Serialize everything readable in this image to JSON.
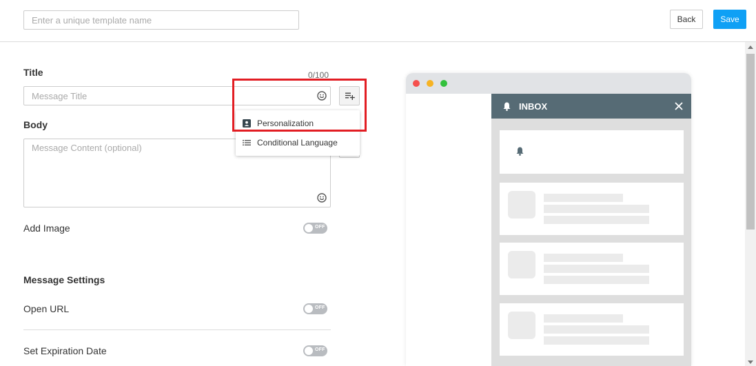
{
  "header": {
    "template_name_placeholder": "Enter a unique template name",
    "back_label": "Back",
    "save_label": "Save"
  },
  "form": {
    "title_label": "Title",
    "title_counter": "0/100",
    "title_placeholder": "Message Title",
    "body_label": "Body",
    "body_placeholder": "Message Content (optional)",
    "add_image_label": "Add Image",
    "add_image_toggle": "OFF",
    "message_settings_label": "Message Settings",
    "open_url_label": "Open URL",
    "open_url_toggle": "OFF",
    "expiration_label": "Set Expiration Date",
    "expiration_toggle": "OFF"
  },
  "dropdown": {
    "items": [
      {
        "label": "Personalization",
        "icon": "contact-card-icon"
      },
      {
        "label": "Conditional Language",
        "icon": "list-icon"
      }
    ]
  },
  "preview": {
    "inbox_title": "INBOX",
    "colors": {
      "header": "#566b75",
      "panel": "#dedede",
      "accent": "#0fa0f5",
      "highlight": "#e21d23"
    }
  }
}
